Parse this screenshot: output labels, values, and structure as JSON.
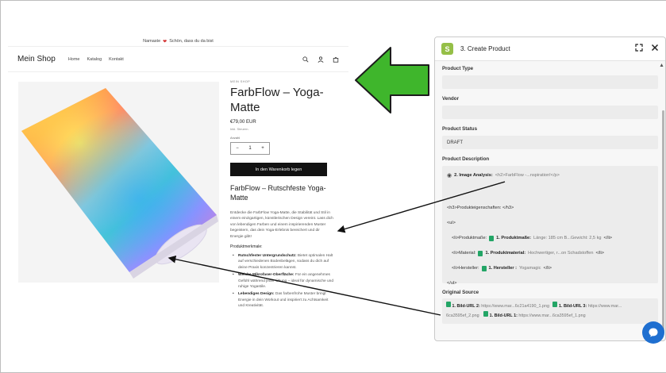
{
  "shop": {
    "announcement": "Namaste",
    "announcement_tail": "Schön, dass du da bist",
    "logo": "Mein Shop",
    "nav": [
      "Home",
      "Katalog",
      "Kontakt"
    ],
    "icons": [
      "search-icon",
      "account-icon",
      "cart-icon"
    ],
    "product": {
      "vendor": "MEIN SHOP",
      "title": "FarbFlow – Yoga-Matte",
      "price": "€79,00 EUR",
      "tax_note": "Inkl. Steuern.",
      "qty_label": "Anzahl",
      "qty_value": "1",
      "qty_minus": "−",
      "qty_plus": "+",
      "cart_button": "In den Warenkorb legen",
      "subtitle": "FarbFlow – Rutschfeste Yoga-Matte",
      "description": "Entdecke die FarbFlow Yoga-Matte, die Stabilität und Stil in einem einzigartigen, künstlerischen Design vereint. Lass dich von lebendigen Farben und einem inspirierenden Muster begeistern, das dein Yoga-Erlebnis bereichert und dir Energie gibt!",
      "features_title": "Produktmerkmale:",
      "features": [
        {
          "bold": "Rutschfester Untergrundschutz:",
          "text": " Bietet optimalen Halt auf verschiedenen Bodenbelägen, sodass du dich auf deine Praxis konzentrieren kannst."
        },
        {
          "bold": "Weiche Mikrofaser-Oberfläche:",
          "text": " Für ein angenehmes Gefühl während jeder Übung – ideal für dynamische und ruhige Yogastile."
        },
        {
          "bold": "Lebendiges Design:",
          "text": " Das farbenfrohe Muster bringt Energie in dein Workout und inspiriert zu Achtsamkeit und Kreativität."
        }
      ]
    }
  },
  "panel": {
    "title": "3. Create Product",
    "fields": {
      "product_type_label": "Product Type",
      "product_type_value": "",
      "vendor_label": "Vendor",
      "vendor_value": "",
      "status_label": "Product Status",
      "status_value": "DRAFT",
      "description_label": "Product Description",
      "source_label": "Original Source"
    },
    "description_lines": {
      "image_analysis_chip": "2. Image Analysis:",
      "image_analysis_value": "<h2>FarbFlow -...nspiration!</p>",
      "h3": "<h3>Produkteigenschaften: </h3>",
      "ul_open": "<ul>",
      "li1_prefix": "<li>Produktmaße:",
      "li1_chip": "1. Produktmaße:",
      "li1_value": "Länge: 185 cm B...Gewicht: 2,5 kg",
      "li1_suffix": "</li>",
      "li2_prefix": "<li>Material:",
      "li2_chip": "1. Produktmaterial:",
      "li2_value": "Hochwertiger, r...on Schadstoffen",
      "li2_suffix": "</li>",
      "li3_prefix": "<li>Hersteller:",
      "li3_chip": "1. Hersteller :",
      "li3_value": "Yogamagic",
      "li3_suffix": "</li>",
      "ul_close": "</ul>"
    },
    "source": {
      "chip2": "1. Bild-URL 2:",
      "val2": "https://www.mar...6c21a4190_1.png",
      "chip3": "1. Bild-URL 3:",
      "val3": "https://www.mar...",
      "val3_cont": "6ca3595ef_2.png",
      "chip1": "1. Bild-URL 1:",
      "val1": "https://www.mar...6ca3595ef_1.png"
    }
  },
  "colors": {
    "accent_green": "#3fb62c",
    "shopify_green": "#95bf47",
    "sheets_green": "#23a566",
    "chat_blue": "#1f6fd0",
    "button_dark": "#121212"
  }
}
